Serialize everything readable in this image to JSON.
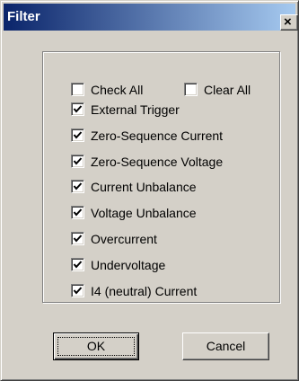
{
  "window": {
    "title": "Filter",
    "close_glyph": "×"
  },
  "bulk": {
    "check_all": {
      "label": "Check All",
      "checked": false
    },
    "clear_all": {
      "label": "Clear All",
      "checked": false
    }
  },
  "filters": [
    {
      "label": "External Trigger",
      "checked": true
    },
    {
      "label": "Zero-Sequence Current",
      "checked": true
    },
    {
      "label": "Zero-Sequence Voltage",
      "checked": true
    },
    {
      "label": "Current Unbalance",
      "checked": true
    },
    {
      "label": "Voltage Unbalance",
      "checked": true
    },
    {
      "label": "Overcurrent",
      "checked": true
    },
    {
      "label": "Undervoltage",
      "checked": true
    },
    {
      "label": "I4 (neutral) Current",
      "checked": true
    }
  ],
  "buttons": {
    "ok": "OK",
    "cancel": "Cancel"
  }
}
